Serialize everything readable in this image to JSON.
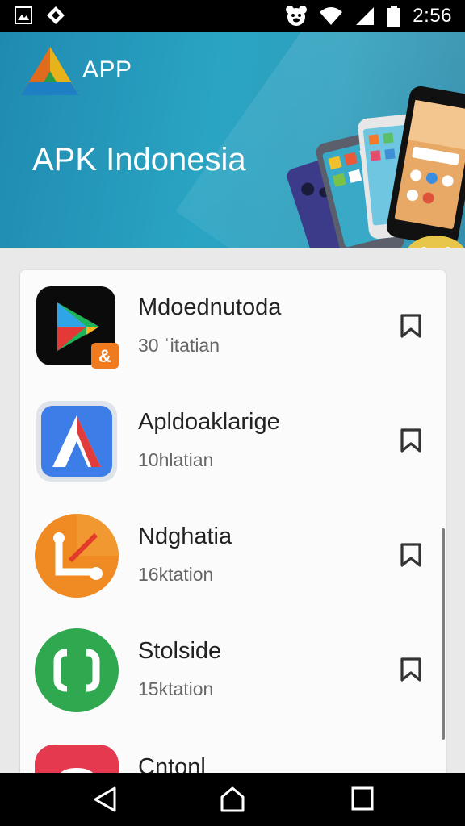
{
  "status_bar": {
    "time": "2:56"
  },
  "header": {
    "logo_label": "APP",
    "title": "APK Indonesia"
  },
  "apps": [
    {
      "name": "Mdoednutoda",
      "subtitle": "30 ˈitatian",
      "icon": "play-store-icon"
    },
    {
      "name": "Apldoaklarige",
      "subtitle": "10hlatian",
      "icon": "red-arrow-app-icon"
    },
    {
      "name": "Ndghatia",
      "subtitle": "16ktation",
      "icon": "orange-link-app-icon"
    },
    {
      "name": "Stolside",
      "subtitle": "15ktation",
      "icon": "green-sync-app-icon"
    },
    {
      "name": "Cntonl",
      "subtitle": "",
      "icon": "red-cloud-app-icon"
    }
  ],
  "colors": {
    "header_start": "#1f8ab0",
    "header_end": "#2aa4c3",
    "card_bg": "#fbfbfb",
    "status_bar": "#000000"
  }
}
